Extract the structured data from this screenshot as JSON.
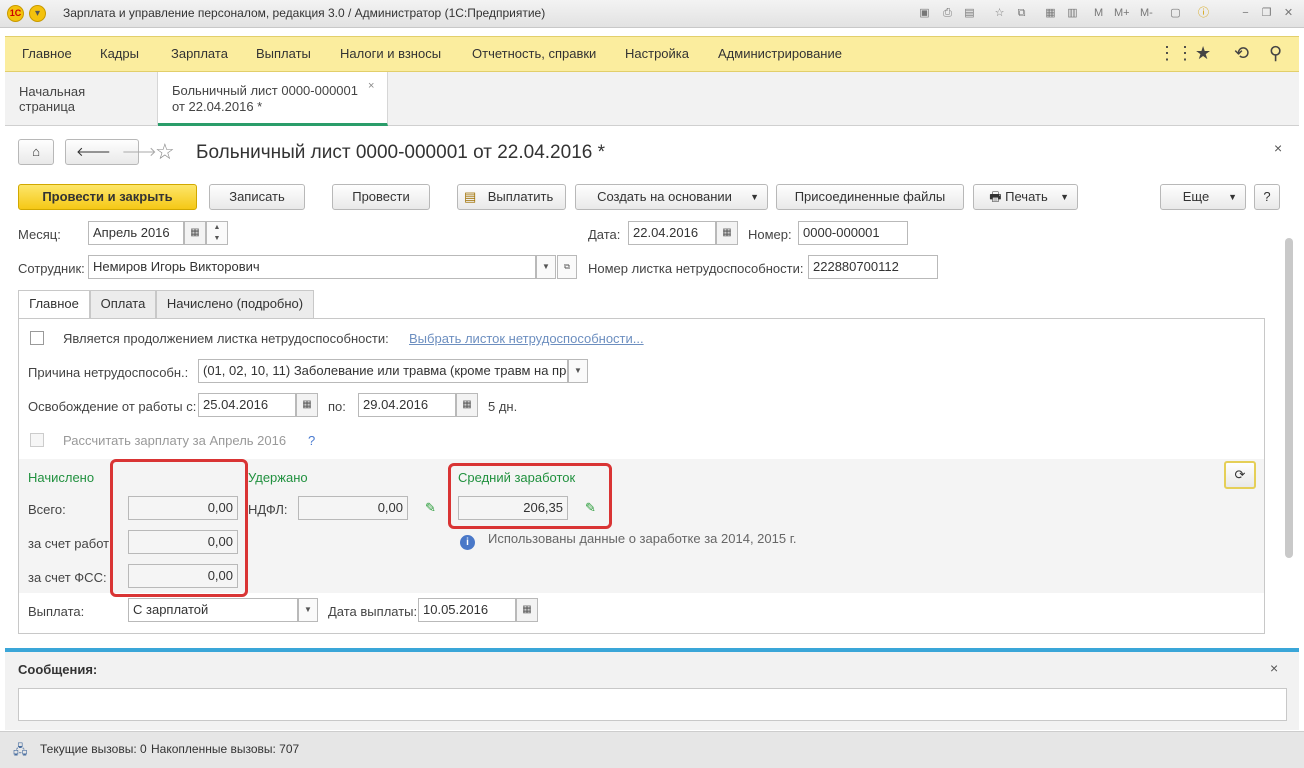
{
  "window": {
    "title": "Зарплата и управление персоналом, редакция 3.0 / Администратор (1С:Предприятие)",
    "toolbar_right": [
      "M",
      "M+",
      "M-"
    ]
  },
  "menu": {
    "items": [
      "Главное",
      "Кадры",
      "Зарплата",
      "Выплаты",
      "Налоги и взносы",
      "Отчетность, справки",
      "Настройка",
      "Администрирование"
    ]
  },
  "open_tabs": [
    {
      "label": "Начальная страница"
    },
    {
      "label_line1": "Больничный лист 0000-000001",
      "label_line2": "от 22.04.2016 *"
    }
  ],
  "document": {
    "title": "Больничный лист 0000-000001 от 22.04.2016 *"
  },
  "toolbar": {
    "post_close": "Провести и закрыть",
    "save": "Записать",
    "post": "Провести",
    "pay": "Выплатить",
    "create_based": "Создать на основании",
    "attached": "Присоединенные файлы",
    "print": "Печать",
    "more": "Еще",
    "help": "?"
  },
  "header": {
    "month_label": "Месяц:",
    "month_value": "Апрель 2016",
    "date_label": "Дата:",
    "date_value": "22.04.2016",
    "number_label": "Номер:",
    "number_value": "0000-000001",
    "employee_label": "Сотрудник:",
    "employee_value": "Немиров Игорь Викторович",
    "sheet_number_label": "Номер листка нетрудоспособности:",
    "sheet_number_value": "222880700112"
  },
  "form_tabs": [
    "Главное",
    "Оплата",
    "Начислено (подробно)"
  ],
  "main": {
    "continuation_label": "Является продолжением листка нетрудоспособности:",
    "continuation_link": "Выбрать листок нетрудоспособности...",
    "reason_label": "Причина нетрудоспособн.:",
    "reason_value": "(01, 02, 10, 11) Заболевание или травма (кроме травм на про",
    "release_label": "Освобождение от работы с:",
    "release_from": "25.04.2016",
    "release_to_label": "по:",
    "release_to": "29.04.2016",
    "days": "5 дн.",
    "calc_salary_label": "Рассчитать зарплату за Апрель 2016",
    "calc_help": "?",
    "accrued_header": "Начислено",
    "withheld_header": "Удержано",
    "avg_header": "Средний заработок",
    "total_label": "Всего:",
    "total_value": "0,00",
    "employer_label": "за счет работ",
    "employer_value": "0,00",
    "fss_label": "за счет ФСС:",
    "fss_value": "0,00",
    "ndfl_label": "НДФЛ:",
    "ndfl_value": "0,00",
    "avg_value": "206,35",
    "avg_info": "Использованы данные о заработке за  2014,  2015 г.",
    "payout_label": "Выплата:",
    "payout_value": "С зарплатой",
    "payout_date_label": "Дата выплаты:",
    "payout_date_value": "10.05.2016"
  },
  "messages": {
    "title": "Сообщения:"
  },
  "status": {
    "current": "Текущие вызовы: 0",
    "accumulated": "Накопленные вызовы: 707"
  }
}
